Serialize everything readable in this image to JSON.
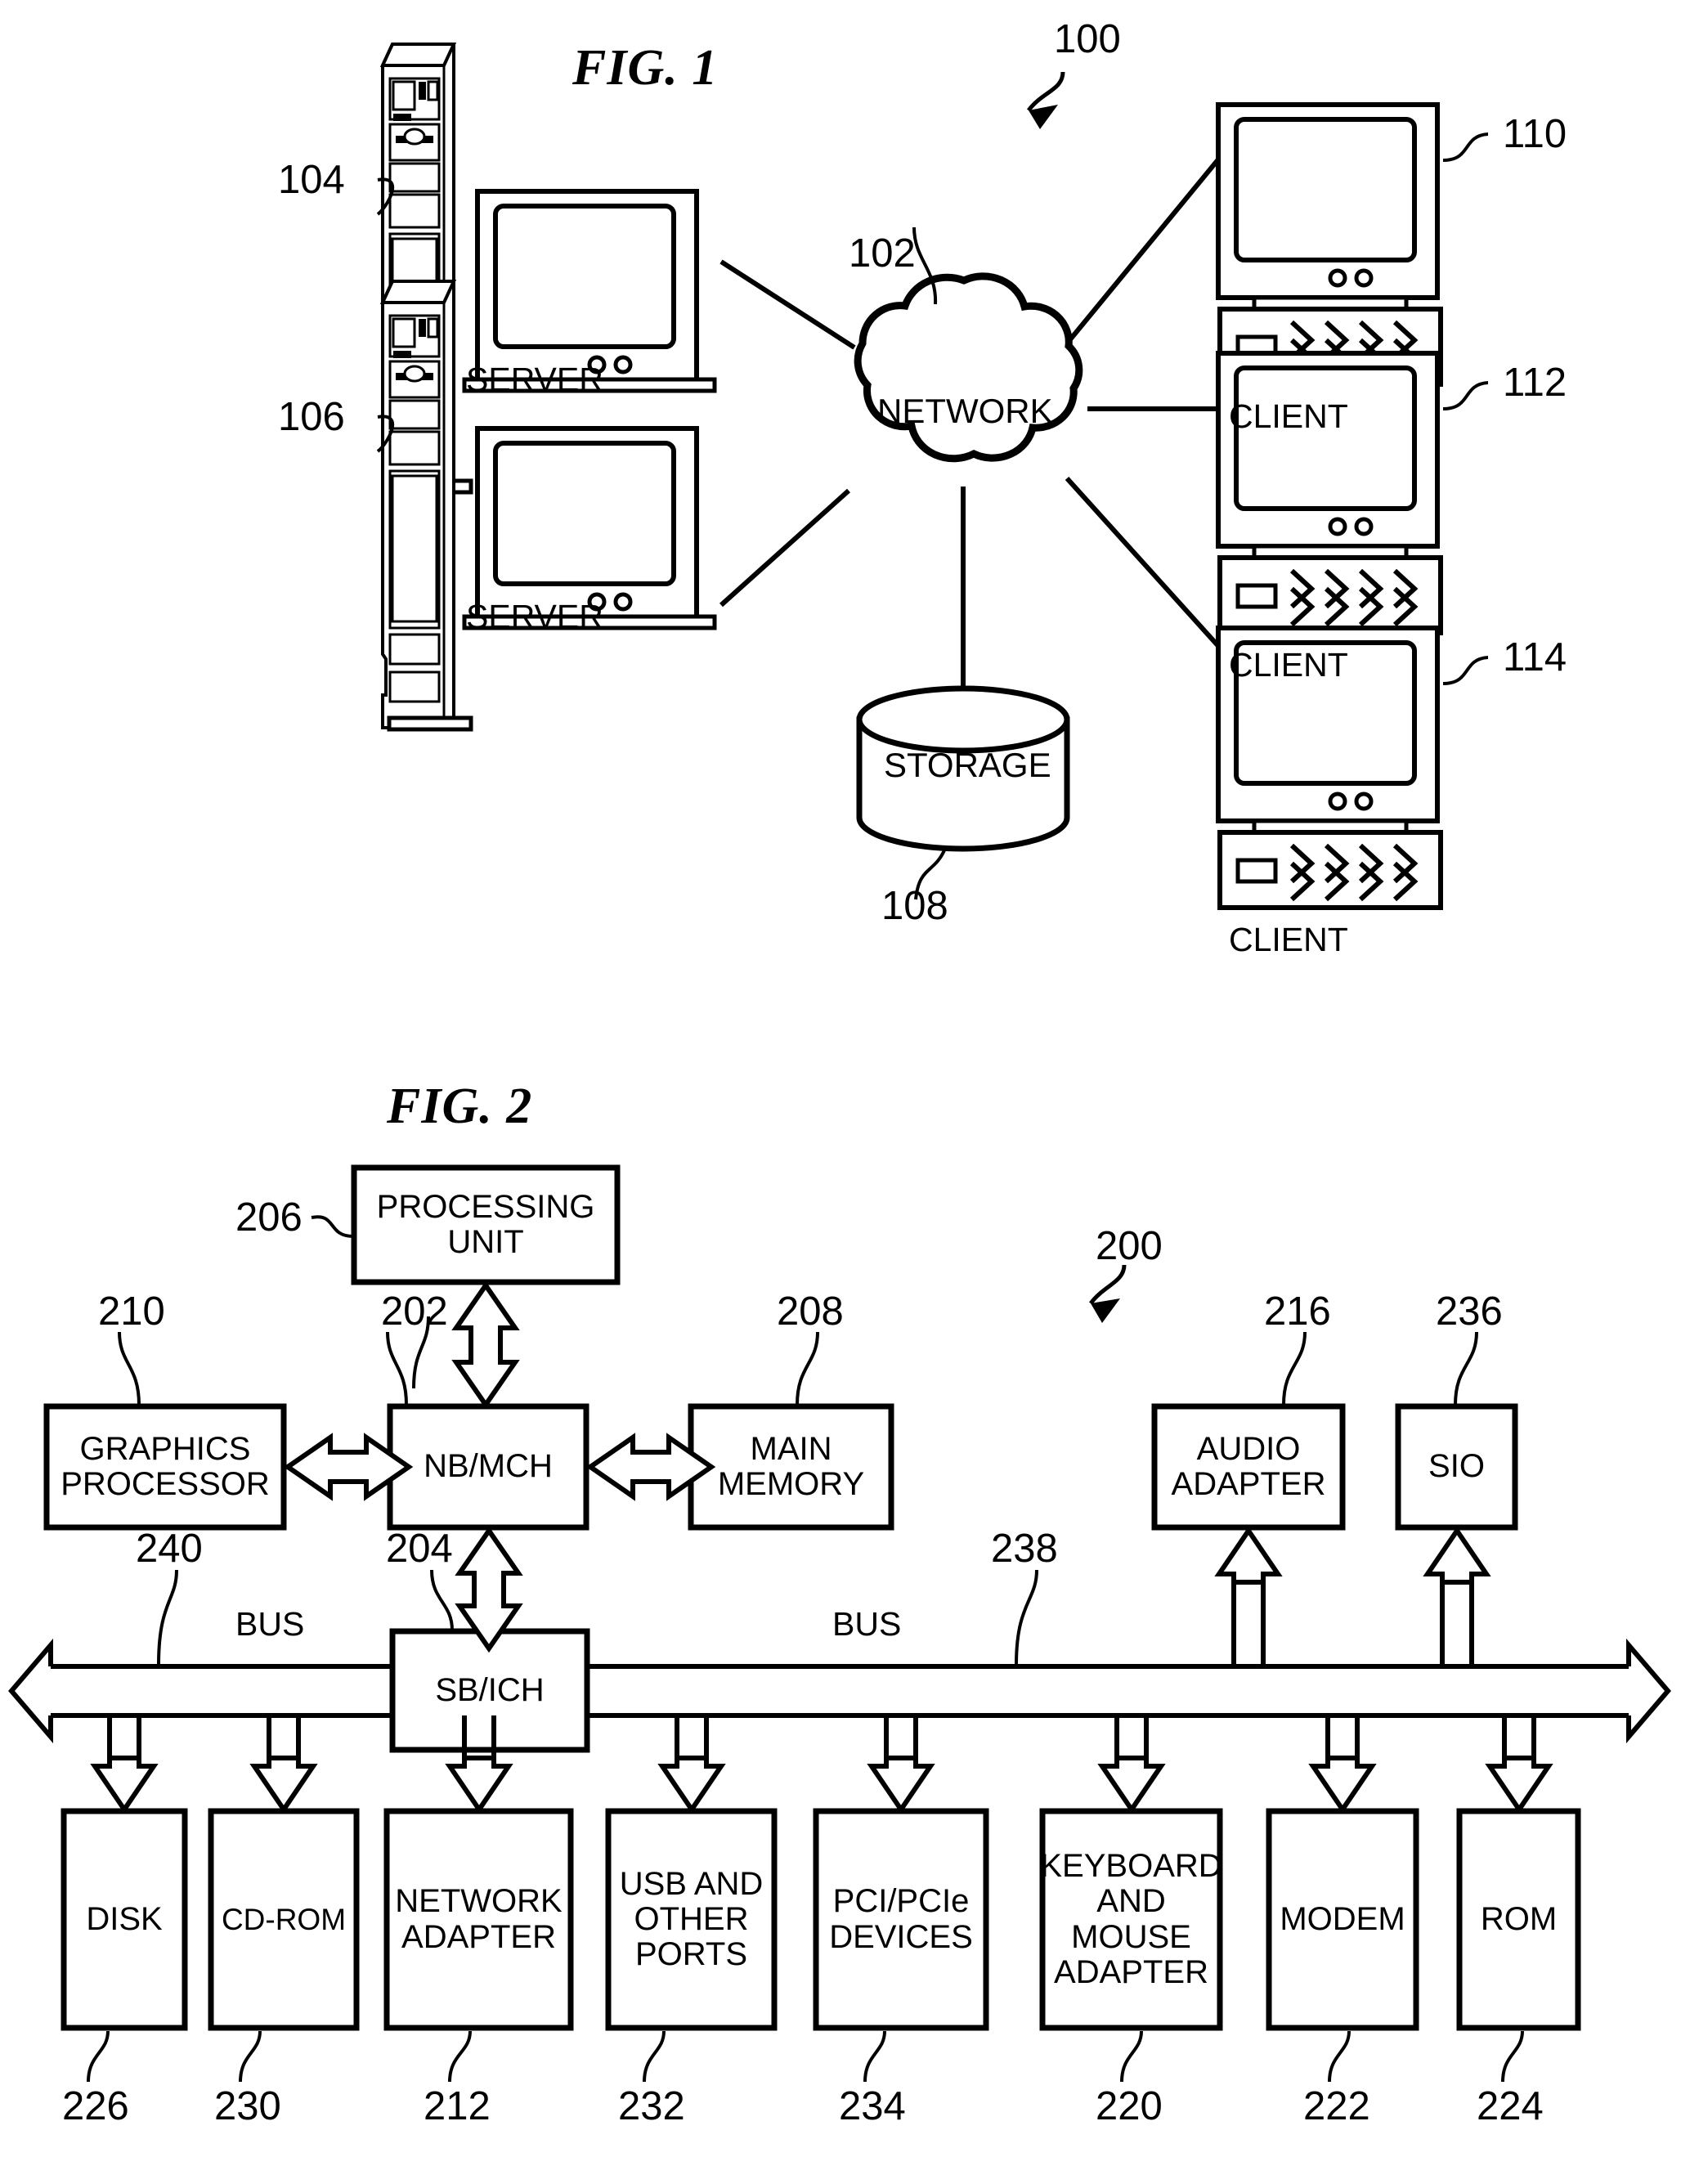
{
  "figures": [
    {
      "id": "fig1",
      "title": "FIG. 1",
      "system_ref": "100",
      "nodes": [
        {
          "ref": "104",
          "label": "SERVER",
          "type": "server-tower-and-monitor"
        },
        {
          "ref": "106",
          "label": "SERVER",
          "type": "server-tower-and-monitor"
        },
        {
          "ref": "102",
          "label": "NETWORK",
          "type": "cloud"
        },
        {
          "ref": "108",
          "label": "STORAGE",
          "type": "cylinder"
        },
        {
          "ref": "110",
          "label": "CLIENT",
          "type": "desktop-computer"
        },
        {
          "ref": "112",
          "label": "CLIENT",
          "type": "desktop-computer"
        },
        {
          "ref": "114",
          "label": "CLIENT",
          "type": "desktop-computer"
        }
      ],
      "links": [
        {
          "from": "104",
          "to": "102"
        },
        {
          "from": "106",
          "to": "102"
        },
        {
          "from": "102",
          "to": "108"
        },
        {
          "from": "102",
          "to": "110"
        },
        {
          "from": "102",
          "to": "112"
        },
        {
          "from": "102",
          "to": "114"
        }
      ]
    },
    {
      "id": "fig2",
      "title": "FIG. 2",
      "system_ref": "200",
      "blocks": [
        {
          "ref": "206",
          "label": "PROCESSING UNIT"
        },
        {
          "ref": "210",
          "label": "GRAPHICS PROCESSOR"
        },
        {
          "ref": "202",
          "label": "NB/MCH"
        },
        {
          "ref": "208",
          "label": "MAIN MEMORY"
        },
        {
          "ref": "216",
          "label": "AUDIO ADAPTER"
        },
        {
          "ref": "236",
          "label": "SIO"
        },
        {
          "ref": "204",
          "label": "SB/ICH"
        },
        {
          "ref": "226",
          "label": "DISK"
        },
        {
          "ref": "230",
          "label": "CD-ROM"
        },
        {
          "ref": "212",
          "label": "NETWORK ADAPTER"
        },
        {
          "ref": "232",
          "label": "USB AND OTHER PORTS"
        },
        {
          "ref": "234",
          "label": "PCI/PCIe DEVICES"
        },
        {
          "ref": "220",
          "label": "KEYBOARD AND MOUSE ADAPTER"
        },
        {
          "ref": "222",
          "label": "MODEM"
        },
        {
          "ref": "224",
          "label": "ROM"
        }
      ],
      "buses": [
        {
          "ref": "240",
          "label": "BUS"
        },
        {
          "ref": "238",
          "label": "BUS"
        }
      ]
    }
  ],
  "fig1": {
    "title": "FIG. 1",
    "ref_100": "100",
    "ref_102": "102",
    "ref_104": "104",
    "ref_106": "106",
    "ref_108": "108",
    "ref_110": "110",
    "ref_112": "112",
    "ref_114": "114",
    "label_network": "NETWORK",
    "label_storage": "STORAGE",
    "label_server_1": "SERVER",
    "label_server_2": "SERVER",
    "label_client_1": "CLIENT",
    "label_client_2": "CLIENT",
    "label_client_3": "CLIENT"
  },
  "fig2": {
    "title": "FIG. 2",
    "ref_200": "200",
    "ref_202": "202",
    "ref_204": "204",
    "ref_206": "206",
    "ref_208": "208",
    "ref_210": "210",
    "ref_212": "212",
    "ref_216": "216",
    "ref_220": "220",
    "ref_222": "222",
    "ref_224": "224",
    "ref_226": "226",
    "ref_230": "230",
    "ref_232": "232",
    "ref_234": "234",
    "ref_236": "236",
    "ref_238": "238",
    "ref_240": "240",
    "label_processing_unit": "PROCESSING UNIT",
    "label_graphics_processor": "GRAPHICS PROCESSOR",
    "label_nb_mch": "NB/MCH",
    "label_main_memory": "MAIN MEMORY",
    "label_audio_adapter": "AUDIO ADAPTER",
    "label_sio": "SIO",
    "label_sb_ich": "SB/ICH",
    "label_bus_left": "BUS",
    "label_bus_right": "BUS",
    "label_disk": "DISK",
    "label_cdrom": "CD-ROM",
    "label_network_adapter": "NETWORK ADAPTER",
    "label_usb_ports": "USB AND OTHER PORTS",
    "label_pci_devices": "PCI/PCIe DEVICES",
    "label_keyboard_mouse": "KEYBOARD AND MOUSE ADAPTER",
    "label_modem": "MODEM",
    "label_rom": "ROM"
  }
}
